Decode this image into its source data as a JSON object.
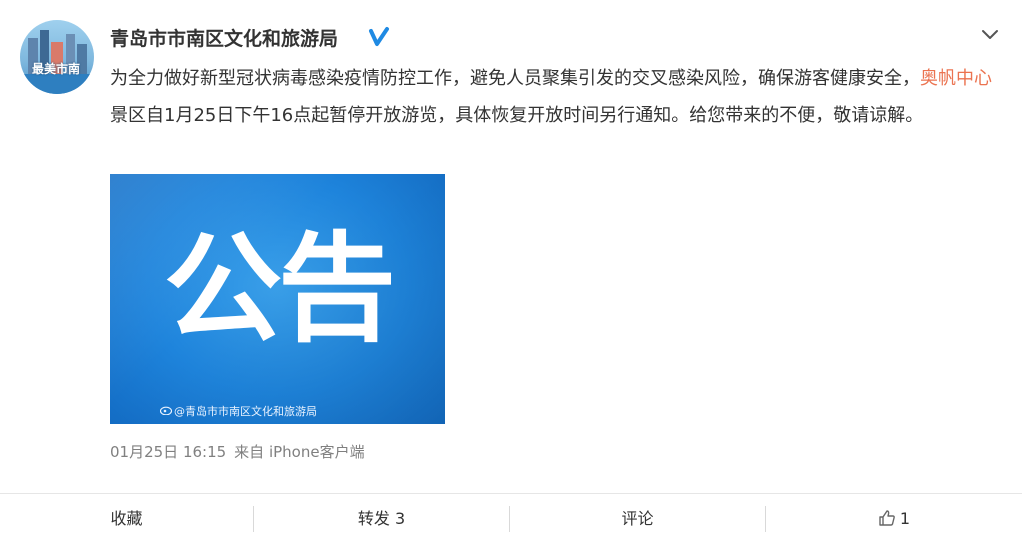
{
  "post": {
    "author": "青岛市市南区文化和旅游局",
    "avatar_text": "最美市南",
    "text_before": "为全力做好新型冠状病毒感染疫情防控工作，避免人员聚集引发的交叉感染风险，确保游客健康安全，",
    "link_text": "奥帆中心",
    "text_after": "景区自1月25日下午16点起暂停开放游览，具体恢复开放时间另行通知。给您带来的不便，敬请谅解。",
    "image_title": "公告",
    "image_watermark": "@青岛市市南区文化和旅游局",
    "time": "01月25日 16:15",
    "source": "来自 iPhone客户端"
  },
  "actions": {
    "favorite": "收藏",
    "repost": "转发 3",
    "comment": "评论",
    "like_count": "1"
  },
  "colors": {
    "link": "#eb7350",
    "verified": "#1f8ae3",
    "poster_blue": "#1e84dc"
  },
  "icons": [
    "verified-icon",
    "chevron-down-icon",
    "weibo-logo-icon",
    "thumbs-up-icon"
  ]
}
